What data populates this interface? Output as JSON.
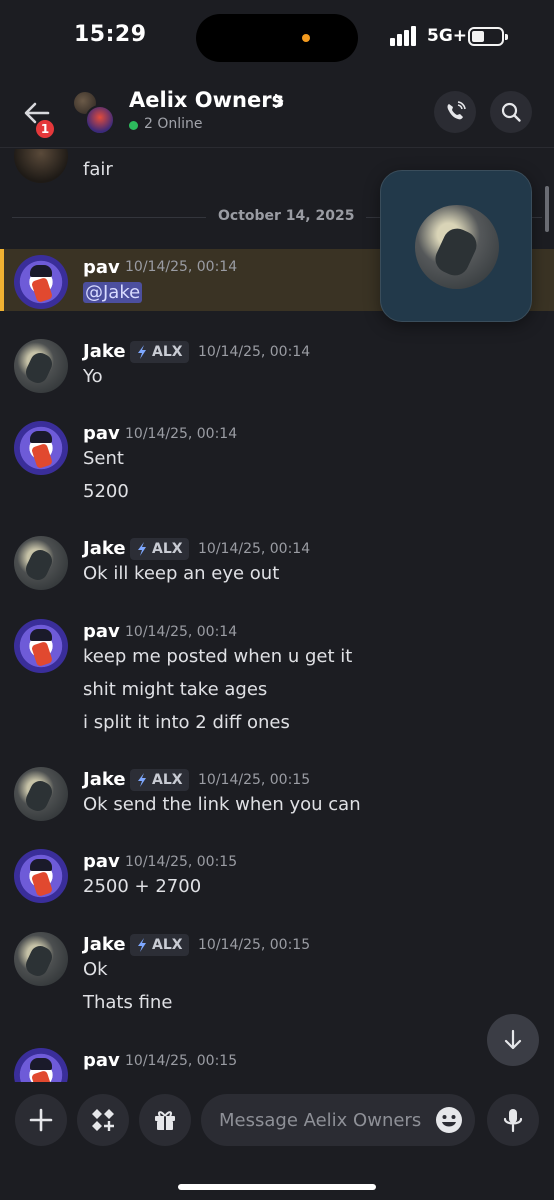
{
  "status": {
    "time": "15:29",
    "network": "5G+"
  },
  "header": {
    "badge": "1",
    "title": "Aelix Owners",
    "online": "2 Online"
  },
  "divider": "October 14, 2025",
  "prev": {
    "text": "fair"
  },
  "highlighted": {
    "name": "pav",
    "ts": "10/14/25, 00:14",
    "mention": "@Jake"
  },
  "messages": [
    {
      "name": "Jake",
      "tag": "ALX",
      "ts": "10/14/25, 00:14",
      "lines": [
        "Yo"
      ]
    },
    {
      "name": "pav",
      "ts": "10/14/25, 00:14",
      "lines": [
        "Sent",
        "5200"
      ]
    },
    {
      "name": "Jake",
      "tag": "ALX",
      "ts": "10/14/25, 00:14",
      "lines": [
        "Ok ill keep an eye out"
      ]
    },
    {
      "name": "pav",
      "ts": "10/14/25, 00:14",
      "lines": [
        "keep me posted when u get it",
        "shit might take ages",
        "i split it into 2 diff ones"
      ]
    },
    {
      "name": "Jake",
      "tag": "ALX",
      "ts": "10/14/25, 00:15",
      "lines": [
        "Ok send the link when you can"
      ]
    },
    {
      "name": "pav",
      "ts": "10/14/25, 00:15",
      "lines": [
        "2500 + 2700"
      ]
    },
    {
      "name": "Jake",
      "tag": "ALX",
      "ts": "10/14/25, 00:15",
      "lines": [
        "Ok",
        "Thats fine"
      ]
    },
    {
      "name": "pav",
      "ts": "10/14/25, 00:15",
      "lines": []
    }
  ],
  "composer": {
    "placeholder": "Message Aelix Owners"
  },
  "icons": {
    "back": "arrow-left-icon",
    "call": "phone-icon",
    "search": "search-icon",
    "add": "plus-icon",
    "apps": "apps-icon",
    "gift": "gift-icon",
    "emoji": "emoji-icon",
    "mic": "mic-icon",
    "jump": "arrow-down-icon"
  },
  "colors": {
    "online": "#2dbb5d",
    "highlight_bar": "#f0b232",
    "badge": "#e5383b",
    "mention_bg": "#4c4f9e"
  }
}
